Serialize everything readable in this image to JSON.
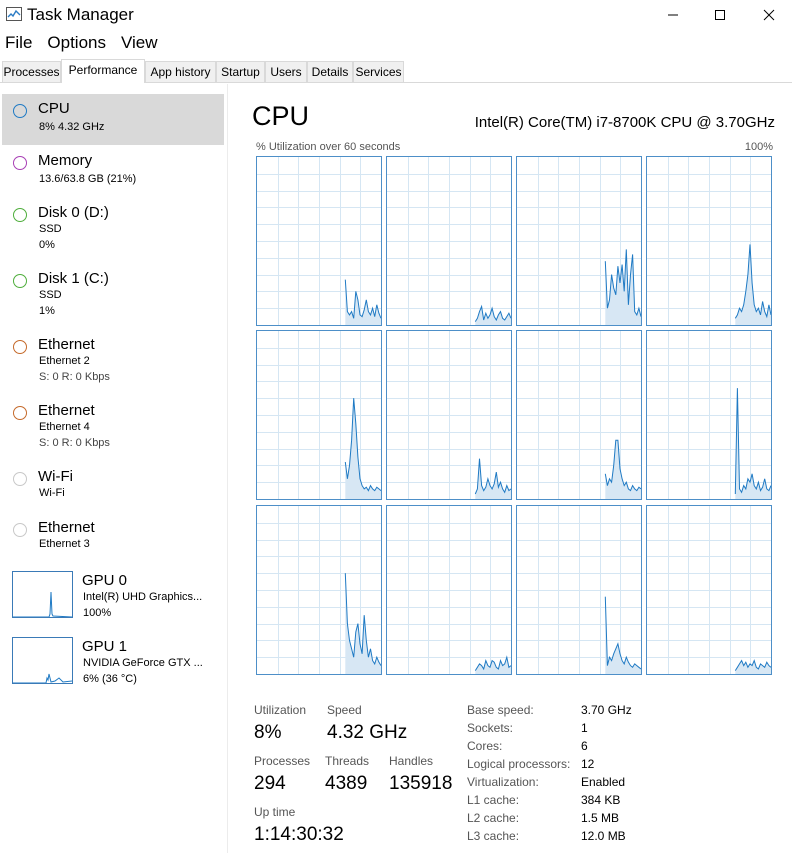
{
  "window": {
    "title": "Task Manager",
    "icon": "task-manager-icon"
  },
  "menu": [
    "File",
    "Options",
    "View"
  ],
  "tabs": [
    "Processes",
    "Performance",
    "App history",
    "Startup",
    "Users",
    "Details",
    "Services"
  ],
  "active_tab": "Performance",
  "sidebar": [
    {
      "title": "CPU",
      "lines": [
        "8% 4.32 GHz"
      ],
      "color": "#1f7ac4",
      "selected": true
    },
    {
      "title": "Memory",
      "lines": [
        "13.6/63.8 GB (21%)"
      ],
      "color": "#a83fb5"
    },
    {
      "title": "Disk 0 (D:)",
      "lines": [
        "SSD",
        "0%"
      ],
      "color": "#4fae3c"
    },
    {
      "title": "Disk 1 (C:)",
      "lines": [
        "SSD",
        "1%"
      ],
      "color": "#4fae3c"
    },
    {
      "title": "Ethernet",
      "lines": [
        "Ethernet 2",
        "S: 0 R: 0 Kbps"
      ],
      "color": "#c56a2b"
    },
    {
      "title": "Ethernet",
      "lines": [
        "Ethernet 4",
        "S: 0 R: 0 Kbps"
      ],
      "color": "#c56a2b"
    },
    {
      "title": "Wi-Fi",
      "lines": [
        "Wi-Fi"
      ],
      "color": "#b8b8b8"
    },
    {
      "title": "Ethernet",
      "lines": [
        "Ethernet 3"
      ],
      "color": "#b8b8b8"
    },
    {
      "title": "GPU 0",
      "lines": [
        "Intel(R) UHD Graphics...",
        "100%"
      ],
      "color": "#1f7ac4",
      "gpu": true
    },
    {
      "title": "GPU 1",
      "lines": [
        "NVIDIA GeForce GTX ...",
        "6% (36 °C)"
      ],
      "color": "#1f7ac4",
      "gpu": true
    }
  ],
  "main": {
    "title": "CPU",
    "model": "Intel(R) Core(TM) i7-8700K CPU @ 3.70GHz",
    "util_label": "% Utilization over 60 seconds",
    "util_max": "100%"
  },
  "stats": {
    "utilization_label": "Utilization",
    "utilization": "8%",
    "speed_label": "Speed",
    "speed": "4.32 GHz",
    "processes_label": "Processes",
    "processes": "294",
    "threads_label": "Threads",
    "threads": "4389",
    "handles_label": "Handles",
    "handles": "135918",
    "uptime_label": "Up time",
    "uptime": "1:14:30:32"
  },
  "info": [
    {
      "label": "Base speed:",
      "value": "3.70 GHz"
    },
    {
      "label": "Sockets:",
      "value": "1"
    },
    {
      "label": "Cores:",
      "value": "6"
    },
    {
      "label": "Logical processors:",
      "value": "12"
    },
    {
      "label": "Virtualization:",
      "value": "Enabled"
    },
    {
      "label": "L1 cache:",
      "value": "384 KB"
    },
    {
      "label": "L2 cache:",
      "value": "1.5 MB"
    },
    {
      "label": "L3 cache:",
      "value": "12.0 MB"
    }
  ],
  "colors": {
    "graph_line": "#1f7ac4",
    "graph_fill": "#d7e7f4",
    "grid": "#d5e6f3",
    "selected_bg": "#d9d9d9"
  }
}
